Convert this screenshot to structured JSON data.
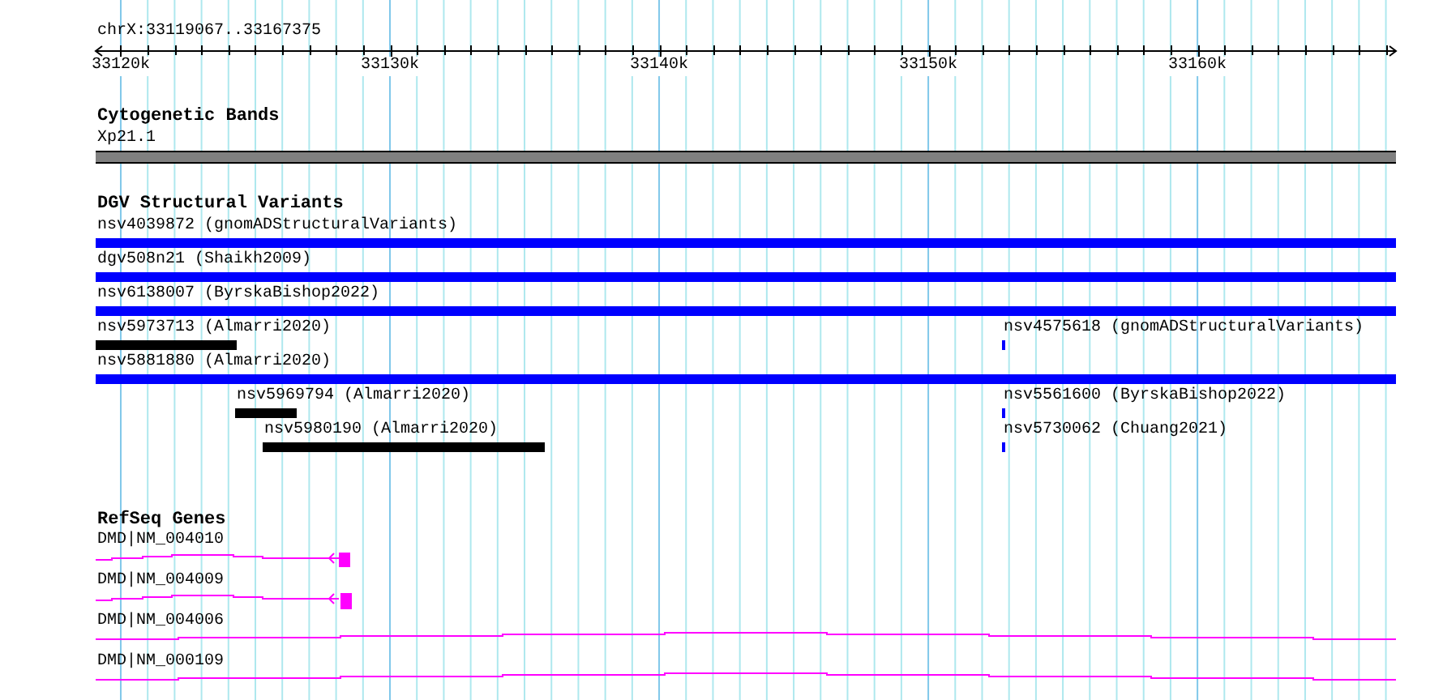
{
  "ruler": {
    "location": "chrX:33119067..33167375",
    "ticks": [
      "33120k",
      "33130k",
      "33140k",
      "33150k",
      "33160k"
    ]
  },
  "tracks": [
    {
      "kind": "bands",
      "title": "Cytogenetic Bands",
      "features": [
        {
          "label": "Xp21.1"
        }
      ]
    },
    {
      "kind": "variants",
      "title": "DGV Structural Variants",
      "features": [
        {
          "label": "nsv4039872 (gnomADStructuralVariants)",
          "color": "#0000ff"
        },
        {
          "label": "dgv508n21 (Shaikh2009)",
          "color": "#0000ff"
        },
        {
          "label": "nsv6138007 (ByrskaBishop2022)",
          "color": "#0000ff"
        },
        {
          "label": "nsv5973713 (Almarri2020)",
          "color": "#000000"
        },
        {
          "label": "nsv4575618 (gnomADStructuralVariants)",
          "color": "#0000ff"
        },
        {
          "label": "nsv5881880 (Almarri2020)",
          "color": "#0000ff"
        },
        {
          "label": "nsv5969794 (Almarri2020)",
          "color": "#000000"
        },
        {
          "label": "nsv5561600 (ByrskaBishop2022)",
          "color": "#0000ff"
        },
        {
          "label": "nsv5980190 (Almarri2020)",
          "color": "#000000"
        },
        {
          "label": "nsv5730062 (Chuang2021)",
          "color": "#0000ff"
        }
      ]
    },
    {
      "kind": "genes",
      "title": "RefSeq Genes",
      "features": [
        {
          "label": "DMD|NM_004010"
        },
        {
          "label": "DMD|NM_004009"
        },
        {
          "label": "DMD|NM_004006"
        },
        {
          "label": "DMD|NM_000109"
        }
      ]
    }
  ]
}
